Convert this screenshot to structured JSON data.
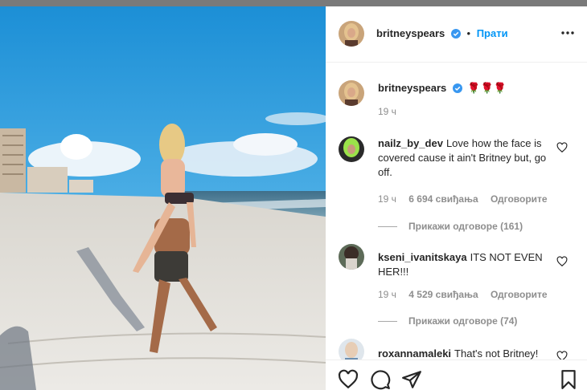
{
  "post": {
    "author": "britneyspears",
    "follow_label": "Прати",
    "separator": "•",
    "more_label": "•••"
  },
  "caption": {
    "username": "britneyspears",
    "text": "🌹🌹🌹",
    "time": "19 ч"
  },
  "comments": [
    {
      "username": "nailz_by_dev",
      "text": "Love how the face is covered cause it ain't Britney but, go off.",
      "time": "19 ч",
      "likes": "6 694 свиђања",
      "reply_label": "Одговорите",
      "view_replies": "Прикажи одговоре (161)"
    },
    {
      "username": "kseni_ivanitskaya",
      "text": "ITS NOT EVEN HER!!!",
      "time": "19 ч",
      "likes": "4 529 свиђања",
      "reply_label": "Одговорите",
      "view_replies": "Прикажи одговоре (74)"
    },
    {
      "username": "roxannamaleki",
      "text": "That's not Britney!"
    }
  ],
  "colors": {
    "link_blue": "#0095f6",
    "verified_blue": "#3897f0",
    "muted_gray": "#8e8e8e"
  },
  "icons": {
    "verified": "verified-badge-icon",
    "more": "more-options-icon",
    "comment_like": "heart-outline-icon",
    "like": "heart-outline-icon",
    "comment": "speech-bubble-icon",
    "share": "paper-plane-icon",
    "save": "bookmark-icon"
  }
}
